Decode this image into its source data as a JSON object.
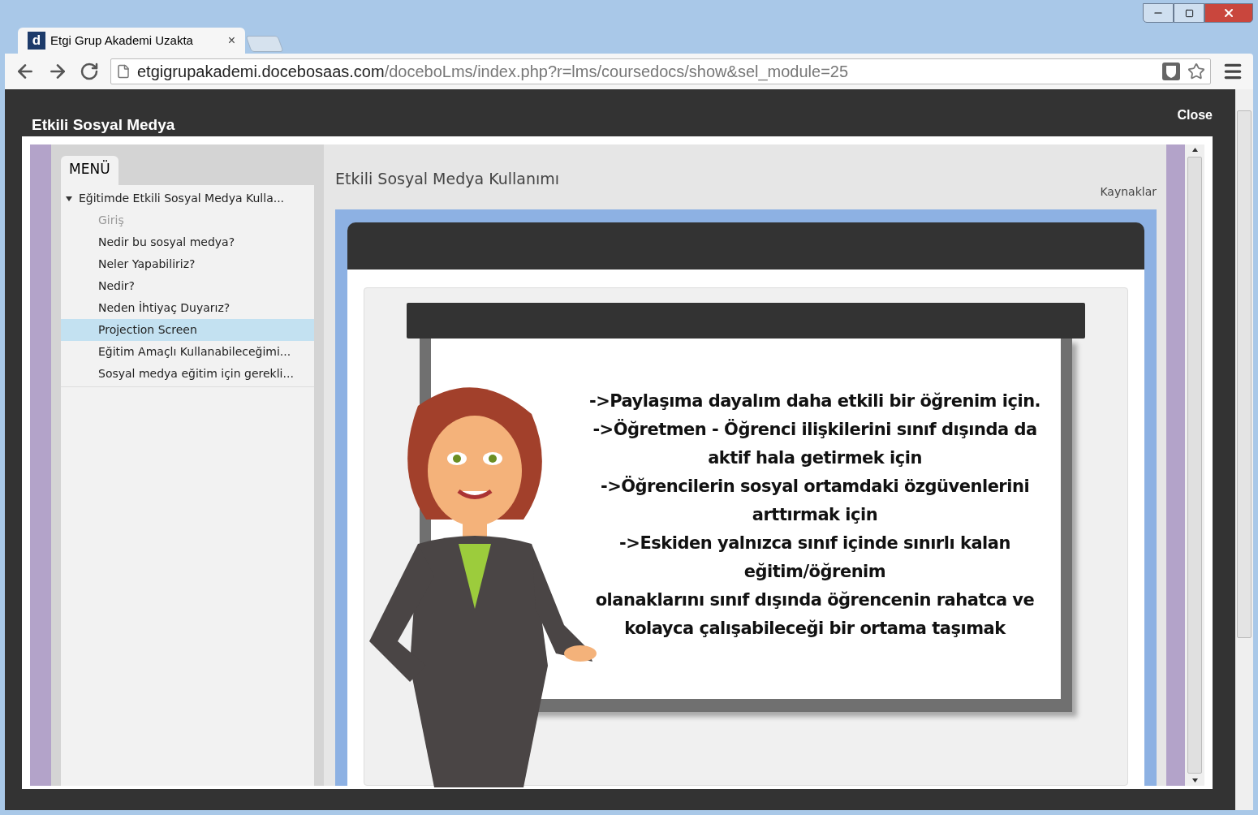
{
  "browser": {
    "tab": {
      "favicon_letter": "d",
      "title": "Etgi Grup Akademi Uzakta",
      "close": "×",
      "selected": true
    },
    "url": {
      "host": "etgigrupakademi.docebosaas.com",
      "path": "/doceboLms/index.php?r=lms/coursedocs/show&sel_module=25"
    }
  },
  "page": {
    "title": "Etkili Sosyal Medya",
    "close": "Close"
  },
  "sidebar": {
    "tab": "MENÜ",
    "tree": [
      {
        "label": "Eğitimde Etkili Sosyal Medya Kulla...",
        "expanded": true,
        "children": [
          {
            "label": "Giriş",
            "dimmed": true,
            "selected": false
          },
          {
            "label": "Nedir bu sosyal medya?",
            "dimmed": false,
            "selected": false
          },
          {
            "label": "Neler Yapabiliriz?",
            "dimmed": false,
            "selected": false
          },
          {
            "label": "Nedir?",
            "dimmed": false,
            "selected": false
          },
          {
            "label": "Neden İhtiyaç Duyarız?",
            "dimmed": false,
            "selected": false
          },
          {
            "label": "Projection Screen",
            "dimmed": false,
            "selected": true
          },
          {
            "label": "Eğitim Amaçlı Kullanabileceğimi...",
            "dimmed": false,
            "selected": false
          },
          {
            "label": "Sosyal medya eğitim için gerekli...",
            "dimmed": false,
            "selected": false
          }
        ]
      }
    ]
  },
  "content": {
    "title": "Etkili Sosyal Medya Kullanımı",
    "link": "Kaynaklar",
    "slide_lines": [
      "->Paylaşıma dayalım daha etkili bir öğrenim için.",
      "->Öğretmen - Öğrenci ilişkilerini sınıf dışında da",
      "aktif hala getirmek için",
      "->Öğrencilerin sosyal ortamdaki özgüvenlerini",
      "arttırmak için",
      "->Eskiden yalnızca sınıf içinde sınırlı kalan",
      "eğitim/öğrenim",
      "olanaklarını sınıf dışında öğrencenin rahatca ve",
      "kolayca çalışabileceği bir ortama taşımak"
    ]
  }
}
